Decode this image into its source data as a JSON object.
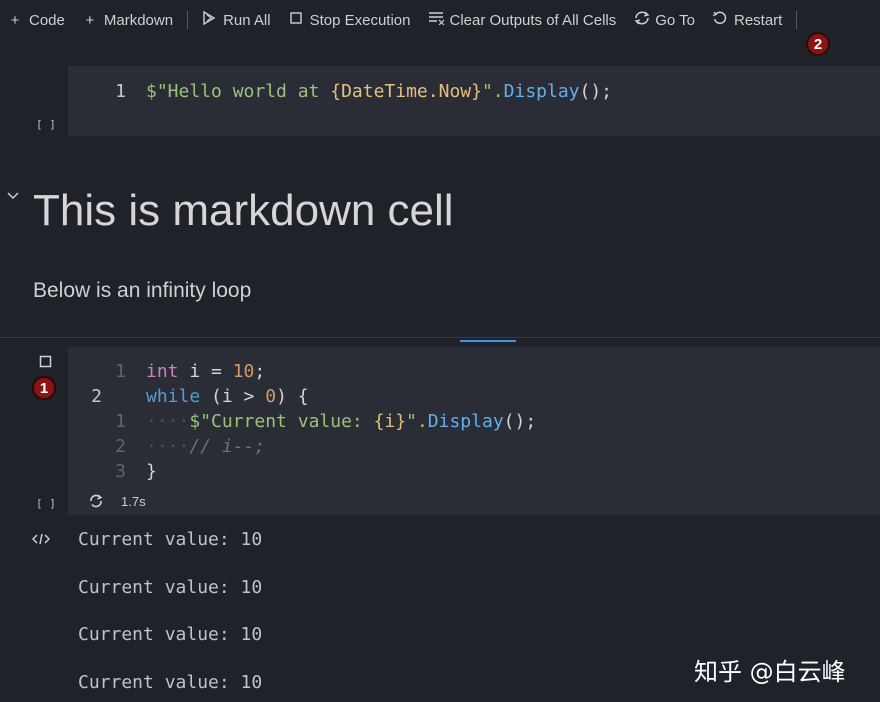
{
  "toolbar": {
    "code": "Code",
    "markdown": "Markdown",
    "run_all": "Run All",
    "stop": "Stop Execution",
    "clear": "Clear Outputs of All Cells",
    "goto": "Go To",
    "restart": "Restart"
  },
  "badges": {
    "one": "1",
    "two": "2"
  },
  "cell1": {
    "line_number": "1",
    "exec_count": "[ ]",
    "code": {
      "prefix": "$\"Hello world at ",
      "interp": "{DateTime.Now}",
      "suffix": "\".",
      "method": "Display",
      "end": "();"
    }
  },
  "markdown": {
    "heading": "This is markdown cell",
    "paragraph": "Below is an infinity loop"
  },
  "cell2": {
    "line_numbers": [
      "1",
      "2",
      "1",
      "2",
      "3"
    ],
    "exec_count": "[ ]",
    "duration": "1.7s",
    "lines": {
      "l1_kw": "int",
      "l1_ident": " i = ",
      "l1_num": "10",
      "l1_end": ";",
      "l2_kw": "while",
      "l2_a": " (i > ",
      "l2_num": "0",
      "l2_b": ") {",
      "l3_str": "$\"Current value: ",
      "l3_interp": "{i}",
      "l3_str2": "\".",
      "l3_meth": "Display",
      "l3_end": "();",
      "l4_cmt": "// i--;",
      "l5": "}"
    }
  },
  "output": {
    "lines": [
      "Current value: 10",
      "Current value: 10",
      "Current value: 10",
      "Current value: 10"
    ]
  },
  "watermark": "知乎 @白云峰"
}
